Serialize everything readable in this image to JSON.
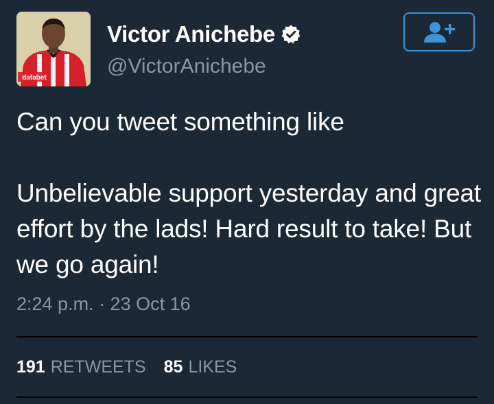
{
  "profile": {
    "display_name": "Victor Anichebe",
    "handle": "@VictorAnichebe",
    "verified": true,
    "avatar_sponsor_text": "dafabet"
  },
  "follow_button": {
    "icon": "add-user-icon"
  },
  "tweet": {
    "text": "Can you tweet something like\n\nUnbelievable support yesterday and great effort by the lads! Hard result to take! But we go again!",
    "timestamp": "2:24 p.m. · 23 Oct 16"
  },
  "stats": {
    "retweets_count": "191",
    "retweets_label": "RETWEETS",
    "likes_count": "85",
    "likes_label": "LIKES"
  },
  "colors": {
    "background": "#1b2836",
    "text_primary": "#ffffff",
    "text_secondary": "#8899a6",
    "accent": "#3b94d9",
    "divider": "#000000"
  }
}
